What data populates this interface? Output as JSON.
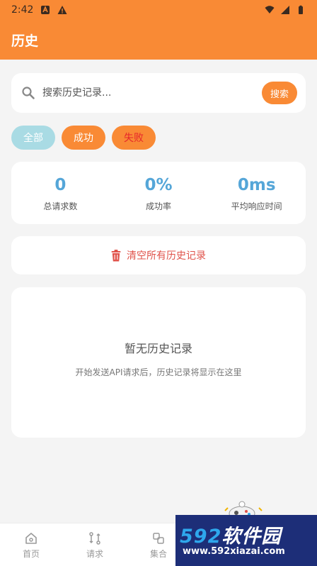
{
  "status_bar": {
    "time": "2:42"
  },
  "app_bar": {
    "title": "历史"
  },
  "search": {
    "placeholder": "搜索历史记录...",
    "button_label": "搜索"
  },
  "filters": [
    {
      "label": "全部"
    },
    {
      "label": "成功"
    },
    {
      "label": "失败"
    }
  ],
  "stats": [
    {
      "value": "0",
      "label": "总请求数"
    },
    {
      "value": "0%",
      "label": "成功率"
    },
    {
      "value": "0ms",
      "label": "平均响应时间"
    }
  ],
  "clear_history": {
    "label": "清空所有历史记录",
    "icon": "trash-icon"
  },
  "empty_state": {
    "title": "暂无历史记录",
    "subtitle": "开始发送API请求后，历史记录将显示在这里"
  },
  "bottom_nav": [
    {
      "label": "首页",
      "icon": "home-icon"
    },
    {
      "label": "请求",
      "icon": "request-icon"
    },
    {
      "label": "集合",
      "icon": "collection-icon"
    }
  ],
  "watermark": {
    "brand_num": "592",
    "brand_text": "软件园",
    "url": "www.592xiazai.com"
  },
  "colors": {
    "accent": "#f98a35",
    "stat_value": "#55a6d8",
    "danger": "#e0534b",
    "chip_all": "#a9dbe4",
    "background": "#f4f4f4"
  }
}
